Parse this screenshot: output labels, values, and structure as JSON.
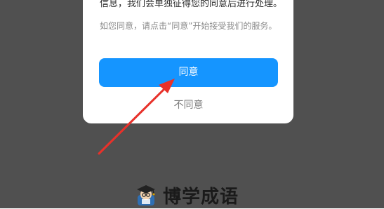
{
  "dialog": {
    "body_line_1": "信息，我们会单独征得您的同意后进行处理。",
    "body_line_2": "如您同意，请点击“同意”开始接受我们的服务。",
    "agree_label": "同意",
    "disagree_label": "不同意"
  },
  "brand": {
    "name": "博学成语",
    "logo_icon": "scholar-mascot-icon"
  },
  "colors": {
    "overlay": "#505050",
    "accent": "#1595ff",
    "annotation_arrow": "#e8312a"
  }
}
